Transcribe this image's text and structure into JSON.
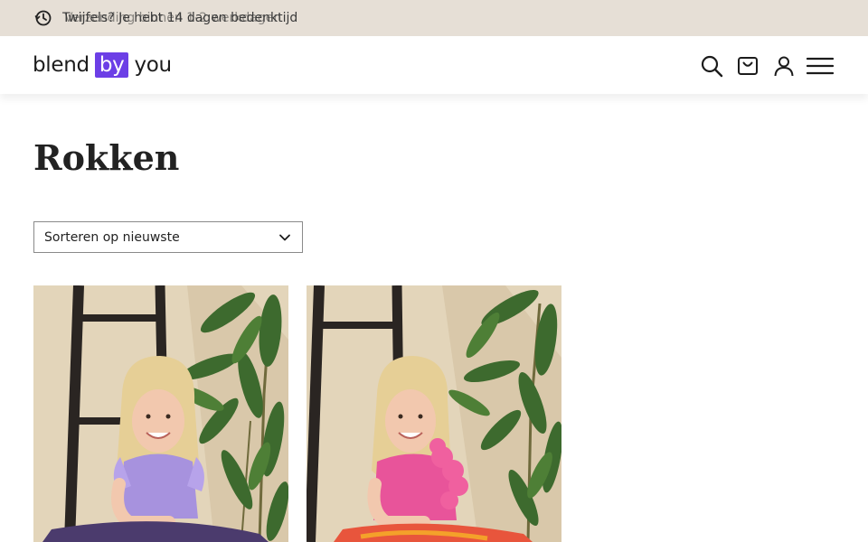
{
  "announcement": {
    "text": "Twijfels? Je hebt 14 dagen bedenktijd",
    "ghost_text": "Verzending binnen 1-2 werkdagen"
  },
  "header": {
    "logo_left": "blend",
    "logo_box": "by",
    "logo_right": "you"
  },
  "page": {
    "title": "Rokken"
  },
  "sort": {
    "selected": "Sorteren op nieuwste"
  },
  "products": [
    {
      "shirt_color": "#a792de",
      "image": "girl-lavender-top-photo"
    },
    {
      "shirt_color": "#e8549a",
      "image": "girl-pink-top-photo"
    }
  ],
  "colors": {
    "brand": "#6c3fe6",
    "announcement_bg": "#e6dfd6"
  }
}
